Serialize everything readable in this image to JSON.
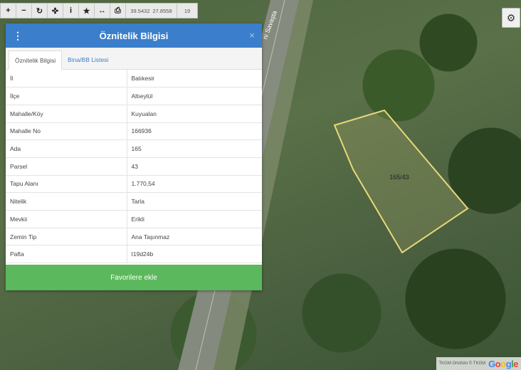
{
  "toolbar": {
    "coord_lat": "39.5432",
    "coord_lon": "27.8558",
    "zoom": "19"
  },
  "map": {
    "parcel_label": "165/43",
    "road_label": "ni Savaşta",
    "attribution_text": "TKGM Ortofoto © TKGM",
    "google_parts": [
      "G",
      "o",
      "o",
      "g",
      "l",
      "e"
    ]
  },
  "panel": {
    "title": "Öznitelik Bilgisi",
    "close_glyph": "×",
    "tabs": [
      {
        "label": "Öznitelik Bilgisi"
      },
      {
        "label": "Bina/BB Listesi"
      }
    ],
    "rows": [
      {
        "key": "İl",
        "value": "Balıkesir"
      },
      {
        "key": "İlçe",
        "value": "Altıeylül"
      },
      {
        "key": "Mahalle/Köy",
        "value": "Kuyualan"
      },
      {
        "key": "Mahalle No",
        "value": "166936"
      },
      {
        "key": "Ada",
        "value": "165"
      },
      {
        "key": "Parsel",
        "value": "43"
      },
      {
        "key": "Tapu Alanı",
        "value": "1.770,54"
      },
      {
        "key": "Nitelik",
        "value": "Tarla"
      },
      {
        "key": "Mevkii",
        "value": "Erikli"
      },
      {
        "key": "Zemin Tip",
        "value": "Ana Taşınmaz"
      },
      {
        "key": "Pafta",
        "value": "I19d24b"
      }
    ],
    "favorite_button": "Favorilere ekle"
  },
  "colors": {
    "header": "#3b7fcc",
    "favorite": "#5cb85c",
    "parcel_outline": "#e8d87a"
  }
}
